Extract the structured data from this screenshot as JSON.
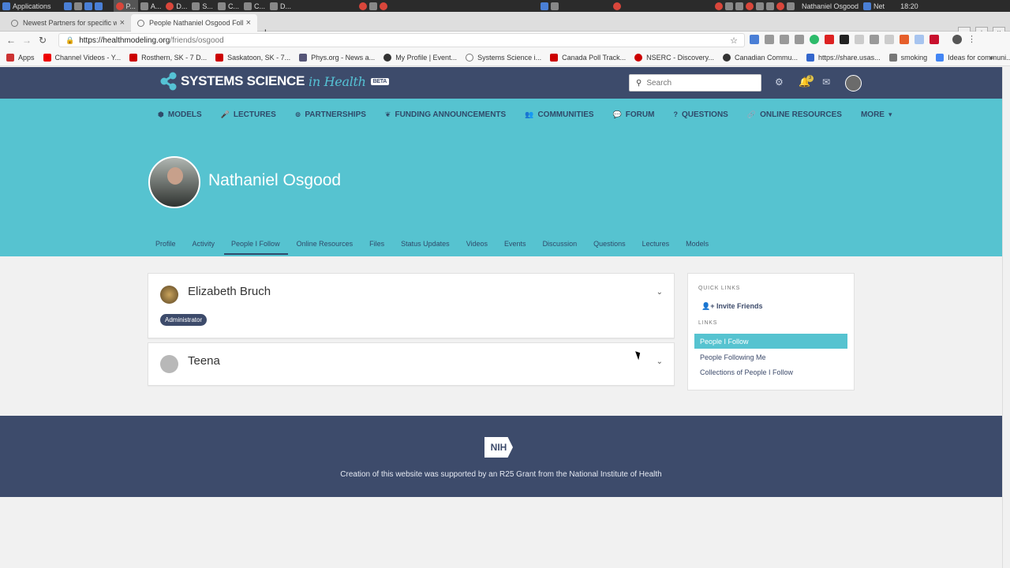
{
  "os": {
    "applications_label": "Applications",
    "user_name": "Nathaniel Osgood",
    "net_label": "Net",
    "clock": "18:20"
  },
  "browser": {
    "tabs": [
      {
        "title": "Newest Partners for specific w"
      },
      {
        "title": "People Nathaniel Osgood Follo"
      }
    ],
    "url_host": "https://healthmodeling.org",
    "url_path": "/friends/osgood",
    "bookmarks": [
      "Apps",
      "Channel Videos - Y...",
      "Rosthern, SK - 7 D...",
      "Saskatoon, SK - 7...",
      "Phys.org - News a...",
      "My Profile | Event...",
      "Systems Science i...",
      "Canada Poll Track...",
      "NSERC - Discovery...",
      "Canadian Commu...",
      "https://share.usas...",
      "smoking",
      "Ideas for communi..."
    ]
  },
  "site": {
    "logo_main": "SYSTEMS SCIENCE",
    "logo_italic": "in Health",
    "logo_badge": "BETA",
    "search_placeholder": "Search",
    "notification_count": "3",
    "menu": [
      {
        "label": "MODELS",
        "icon": "cube-icon",
        "glyph": "⬢"
      },
      {
        "label": "LECTURES",
        "icon": "microphone-icon",
        "glyph": "🎤"
      },
      {
        "label": "PARTNERSHIPS",
        "icon": "handshake-icon",
        "glyph": "⊚"
      },
      {
        "label": "FUNDING ANNOUNCEMENTS",
        "icon": "leaf-icon",
        "glyph": "❦"
      },
      {
        "label": "COMMUNITIES",
        "icon": "users-icon",
        "glyph": "👥"
      },
      {
        "label": "FORUM",
        "icon": "comments-icon",
        "glyph": "💬"
      },
      {
        "label": "QUESTIONS",
        "icon": "question-icon",
        "glyph": "?"
      },
      {
        "label": "ONLINE RESOURCES",
        "icon": "link-icon",
        "glyph": "🔗"
      },
      {
        "label": "MORE",
        "icon": "caret-down-icon",
        "glyph": "▾"
      }
    ],
    "profile_name": "Nathaniel Osgood",
    "profile_tabs": [
      "Profile",
      "Activity",
      "People I Follow",
      "Online Resources",
      "Files",
      "Status Updates",
      "Videos",
      "Events",
      "Discussion",
      "Questions",
      "Lectures",
      "Models"
    ],
    "active_profile_tab": "People I Follow",
    "following": [
      {
        "name": "Elizabeth Bruch",
        "role": "Administrator"
      },
      {
        "name": "Teena",
        "role": ""
      }
    ],
    "sidebar": {
      "quick_links_header": "QUICK LINKS",
      "invite_label": "Invite Friends",
      "links_header": "LINKS",
      "links": [
        "People I Follow",
        "People Following Me",
        "Collections of People I Follow"
      ]
    },
    "footer": {
      "logo_text": "NIH",
      "text": "Creation of this website was supported by an R25 Grant from the National Institute of Health"
    }
  },
  "colors": {
    "navy": "#3d4b6b",
    "teal": "#56c3d0"
  }
}
